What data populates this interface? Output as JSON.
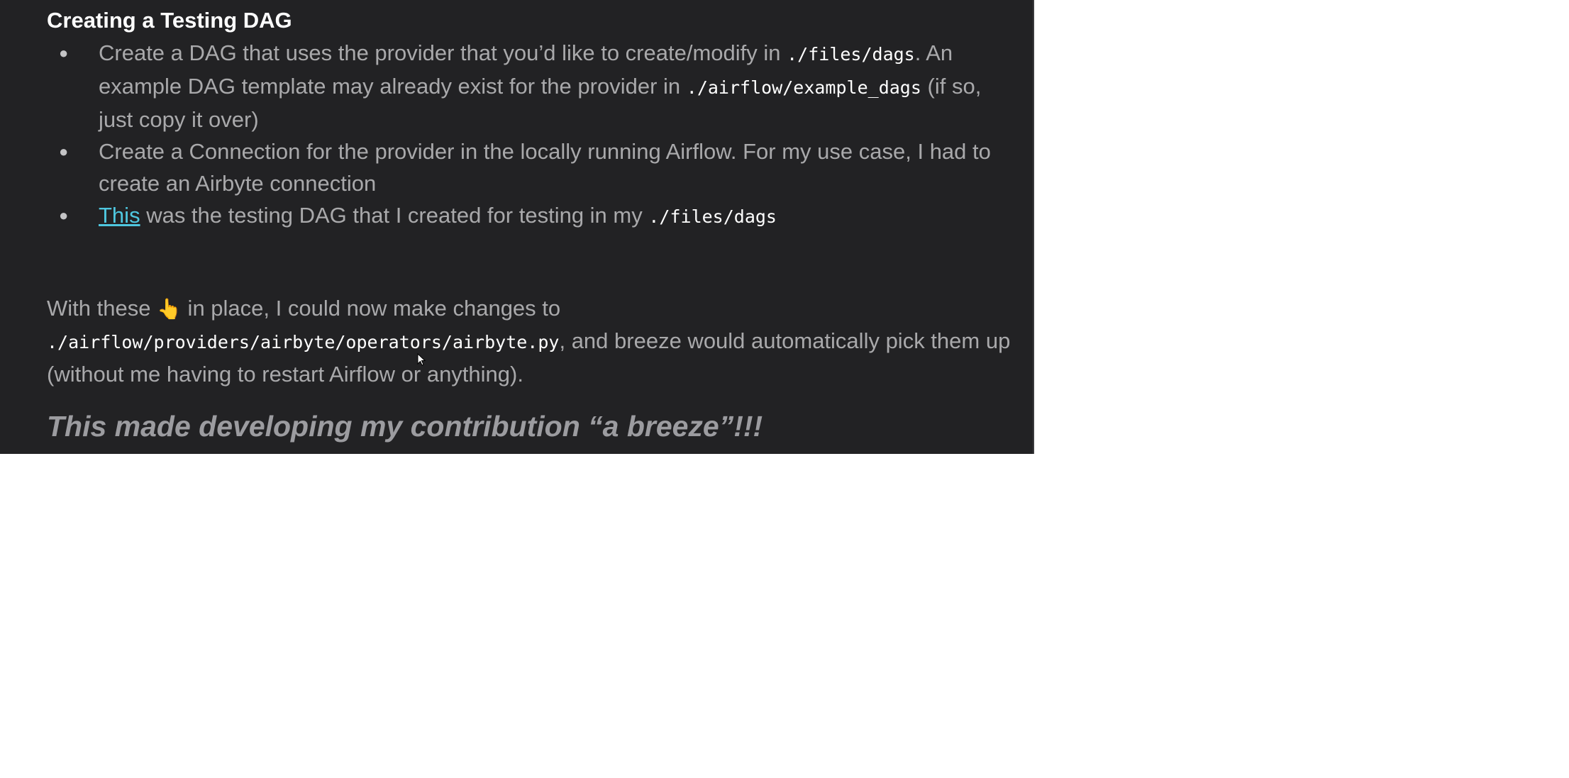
{
  "section": {
    "heading": "Creating a Testing DAG"
  },
  "bullets": [
    {
      "bullet_glyph": "●",
      "t1": "Create a DAG that uses the provider that you’d like to create/modify in ",
      "c1": "./files/dags",
      "t2": ". An example DAG template may already exist for the provider in ",
      "c2": "./airflow/example_dags",
      "t3": " (if so, just copy it over)"
    },
    {
      "bullet_glyph": "●",
      "t1": "Create a Connection for the provider in the locally running Airflow. For my use case, I had to create an Airbyte connection"
    },
    {
      "bullet_glyph": "●",
      "link": "This",
      "t1": " was the testing DAG that I created for testing in my ",
      "c1": "./files/dags"
    }
  ],
  "paragraph": {
    "t1": "With these ",
    "emoji": "👆",
    "t2": " in place, I could now make changes to ",
    "c1": "./airflow/providers/airbyte/operators/airbyte.py",
    "t3": ", and breeze would automatically pick them up (without me having to restart Airflow or anything)."
  },
  "closing": "This made developing my contribution “a breeze”!!!",
  "colors": {
    "background": "#222224",
    "text": "#a9a9ab",
    "heading": "#ffffff",
    "link": "#4fc7df",
    "code": "#ffffff"
  },
  "icons": {
    "emoji": "pointing-up-hand-icon",
    "cursor": "mouse-pointer-icon"
  }
}
